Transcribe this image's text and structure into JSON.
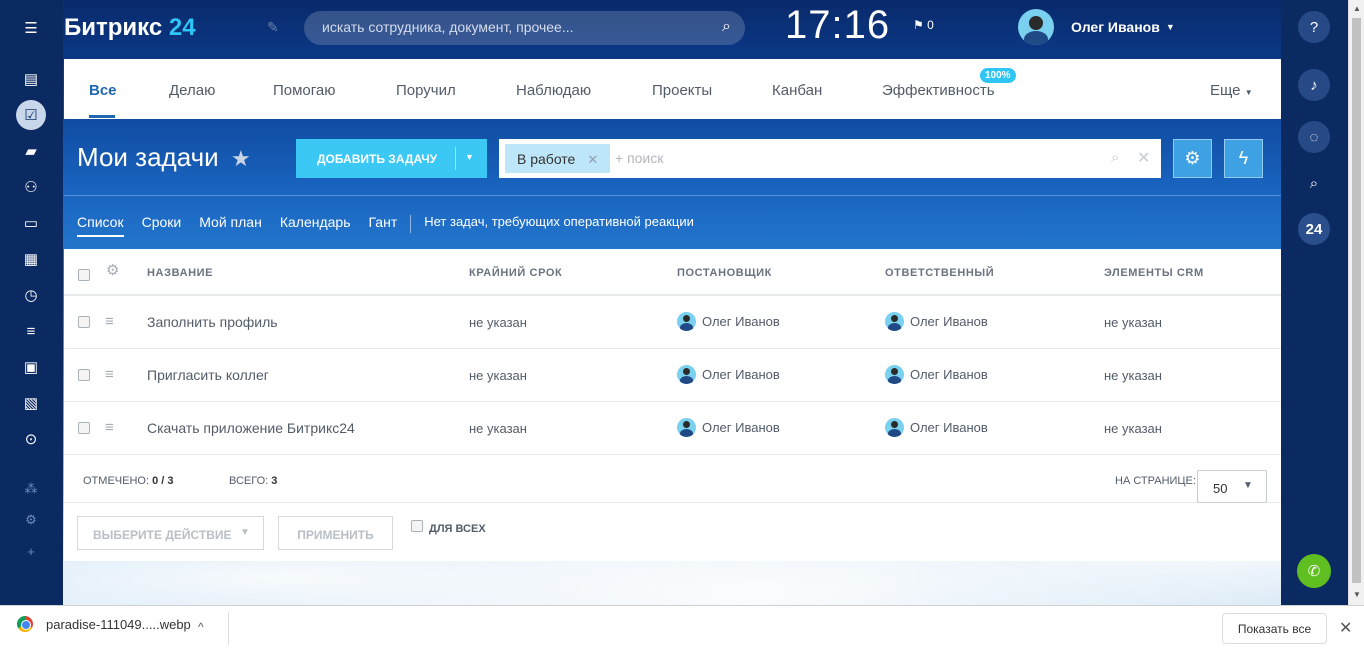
{
  "brand": {
    "name": "Битрикс",
    "num": "24"
  },
  "search": {
    "placeholder": "искать сотрудника, документ, прочее..."
  },
  "clock": "17:16",
  "flag_count": "0",
  "user": {
    "name": "Олег Иванов"
  },
  "topnav": {
    "tabs": [
      "Все",
      "Делаю",
      "Помогаю",
      "Поручил",
      "Наблюдаю",
      "Проекты",
      "Канбан",
      "Эффективность"
    ],
    "efficiency_badge": "100%",
    "more": "Еще"
  },
  "page": {
    "title": "Мои задачи"
  },
  "add_button": "ДОБАВИТЬ ЗАДАЧУ",
  "filter": {
    "chip": "В работе",
    "placeholder": "+ поиск"
  },
  "views": [
    "Список",
    "Сроки",
    "Мой план",
    "Календарь",
    "Гант"
  ],
  "views_message": "Нет задач, требующих оперативной реакции",
  "grid": {
    "columns": [
      "НАЗВАНИЕ",
      "КРАЙНИЙ СРОК",
      "ПОСТАНОВЩИК",
      "ОТВЕТСТВЕННЫЙ",
      "ЭЛЕМЕНТЫ CRM"
    ],
    "rows": [
      {
        "title": "Заполнить профиль",
        "deadline": "не указан",
        "creator": "Олег Иванов",
        "responsible": "Олег Иванов",
        "crm": "не указан"
      },
      {
        "title": "Пригласить коллег",
        "deadline": "не указан",
        "creator": "Олег Иванов",
        "responsible": "Олег Иванов",
        "crm": "не указан"
      },
      {
        "title": "Скачать приложение Битрикс24",
        "deadline": "не указан",
        "creator": "Олег Иванов",
        "responsible": "Олег Иванов",
        "crm": "не указан"
      }
    ],
    "footer": {
      "selected_label": "ОТМЕЧЕНО:",
      "selected_value": "0 / 3",
      "total_label": "ВСЕГО:",
      "total_value": "3",
      "per_page_label": "НА СТРАНИЦЕ:",
      "per_page_value": "50"
    },
    "actions": {
      "select_action": "ВЫБЕРИТЕ ДЕЙСТВИЕ",
      "apply": "ПРИМЕНИТЬ",
      "for_all": "ДЛЯ ВСЕХ"
    }
  },
  "right_sidebar": {
    "b24": "24"
  },
  "downloads": {
    "file": "paradise-111049.....webp",
    "show_all": "Показать все"
  },
  "colors": {
    "accent": "#2067b0",
    "button": "#3bc8f5",
    "chip": "#bde6f9",
    "sidebar": "#0c2a62",
    "phone": "#5fbf20"
  }
}
